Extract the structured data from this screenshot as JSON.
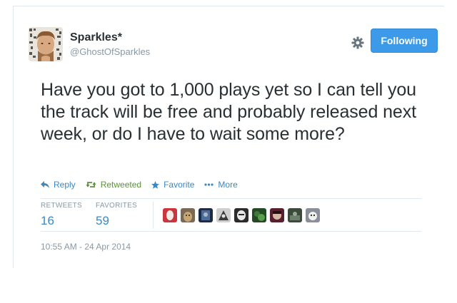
{
  "user": {
    "display_name": "Sparkles*",
    "handle": "@GhostOfSparkles"
  },
  "header": {
    "follow_label": "Following",
    "gear_icon": "gear-icon"
  },
  "tweet": {
    "text": "Have you got to 1,000 plays yet so I can tell you the track will be free and probably released next week, or do I have to wait some more?"
  },
  "actions": [
    {
      "label": "Reply",
      "icon": "reply-icon"
    },
    {
      "label": "Retweeted",
      "icon": "retweet-icon"
    },
    {
      "label": "Favorite",
      "icon": "star-icon"
    },
    {
      "label": "More",
      "icon": "more-dots-icon"
    }
  ],
  "stats": {
    "retweets_label": "RETWEETS",
    "retweets_value": "16",
    "favorites_label": "FAVORITES",
    "favorites_value": "59"
  },
  "favoriters_count_shown": 9,
  "timestamp": "10:55 AM - 24 Apr 2014",
  "colors": {
    "accent": "#3b88c3",
    "follow_button": "#3d9ae8",
    "retweeted": "#5c913b",
    "muted": "#8899a6",
    "text": "#292f33"
  }
}
